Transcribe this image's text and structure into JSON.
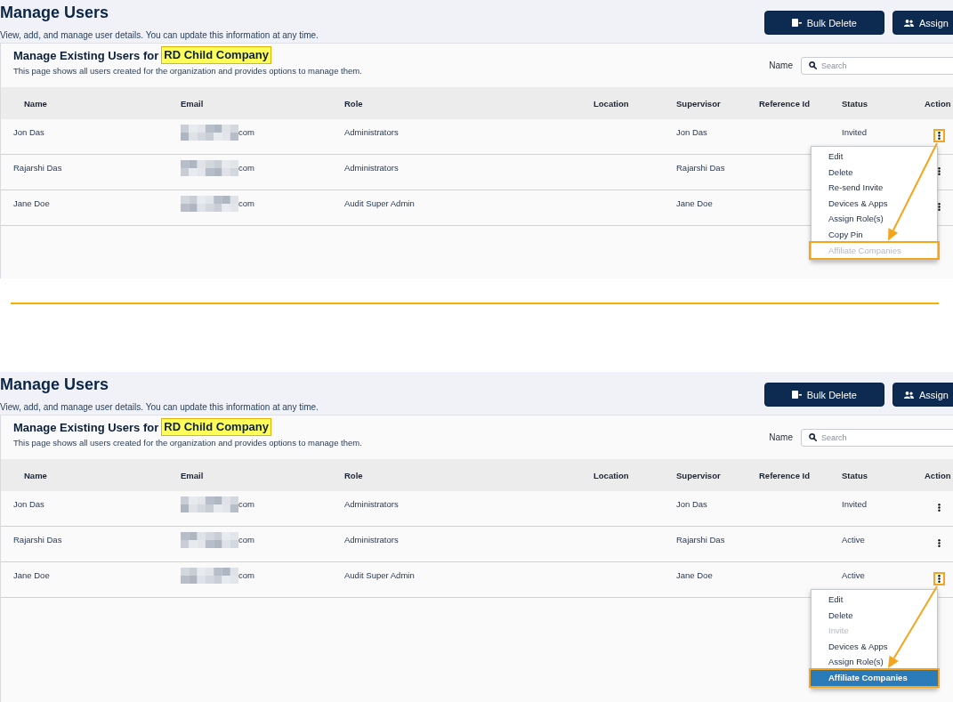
{
  "panels": [
    {
      "title": "Manage Users",
      "subtitle": "View, add, and manage user details. You can update this information at any time.",
      "buttons": [
        "Bulk Delete",
        "Assign"
      ],
      "card": {
        "heading": "Manage Existing Users for",
        "organization": {
          "name": "RD Child Company",
          "highlighted": true
        },
        "description": "This page shows all users created for the organization and provides options to manage them.",
        "filter": {
          "label": "Name",
          "placeholder": "Search"
        }
      },
      "table": {
        "columns": [
          "Name",
          "Email",
          "Role",
          "Location",
          "Supervisor",
          "Reference Id",
          "Status",
          "Action"
        ],
        "rows": [
          {
            "name": "Jon Das",
            "email": {
              "redacted": true,
              "visible": "com"
            },
            "role": "Administrators",
            "supervisor": "Jon Das",
            "status": "Invited",
            "annotated": true,
            "menu": [
              {
                "label": "Edit",
                "disabled": false,
                "selected": false,
                "annotated": false
              },
              {
                "label": "Delete",
                "disabled": false,
                "selected": false,
                "annotated": false
              },
              {
                "label": "Re-send Invite",
                "disabled": false,
                "selected": false,
                "annotated": false
              },
              {
                "label": "Devices & Apps",
                "disabled": false,
                "selected": false,
                "annotated": false
              },
              {
                "label": "Assign Role(s)",
                "disabled": false,
                "selected": false,
                "annotated": false
              },
              {
                "label": "Copy Pin",
                "disabled": false,
                "selected": false,
                "annotated": false
              },
              {
                "label": "Affiliate Companies",
                "disabled": true,
                "selected": false,
                "annotated": true
              }
            ]
          },
          {
            "name": "Rajarshi Das",
            "email": {
              "redacted": true,
              "visible": "com"
            },
            "role": "Administrators",
            "supervisor": "Rajarshi Das",
            "annotated": false
          },
          {
            "name": "Jane Doe",
            "email": {
              "redacted": true,
              "visible": "com"
            },
            "role": "Audit Super Admin",
            "supervisor": "Jane Doe",
            "annotated": false
          }
        ]
      }
    },
    {
      "title": "Manage Users",
      "subtitle": "View, add, and manage user details. You can update this information at any time.",
      "buttons": [
        "Bulk Delete",
        "Assign"
      ],
      "card": {
        "heading": "Manage Existing Users for",
        "organization": {
          "name": "RD Child Company",
          "highlighted": true
        },
        "description": "This page shows all users created for the organization and provides options to manage them.",
        "filter": {
          "label": "Name",
          "placeholder": "Search"
        }
      },
      "table": {
        "columns": [
          "Name",
          "Email",
          "Role",
          "Location",
          "Supervisor",
          "Reference Id",
          "Status",
          "Action"
        ],
        "rows": [
          {
            "name": "Jon Das",
            "email": {
              "redacted": true,
              "visible": "com"
            },
            "role": "Administrators",
            "supervisor": "Jon Das",
            "status": "Invited",
            "annotated": false
          },
          {
            "name": "Rajarshi Das",
            "email": {
              "redacted": true,
              "visible": "com"
            },
            "role": "Administrators",
            "supervisor": "Rajarshi Das",
            "status": "Active",
            "annotated": false
          },
          {
            "name": "Jane Doe",
            "email": {
              "redacted": true,
              "visible": "com"
            },
            "role": "Audit Super Admin",
            "supervisor": "Jane Doe",
            "status": "Active",
            "annotated": true,
            "menu": [
              {
                "label": "Edit",
                "disabled": false,
                "selected": false,
                "annotated": false
              },
              {
                "label": "Delete",
                "disabled": false,
                "selected": false,
                "annotated": false
              },
              {
                "label": "Invite",
                "disabled": true,
                "selected": false,
                "annotated": false
              },
              {
                "label": "Devices & Apps",
                "disabled": false,
                "selected": false,
                "annotated": false
              },
              {
                "label": "Assign Role(s)",
                "disabled": false,
                "selected": false,
                "annotated": false
              },
              {
                "label": "Affiliate Companies",
                "disabled": false,
                "selected": true,
                "annotated": true
              }
            ]
          }
        ]
      }
    }
  ]
}
